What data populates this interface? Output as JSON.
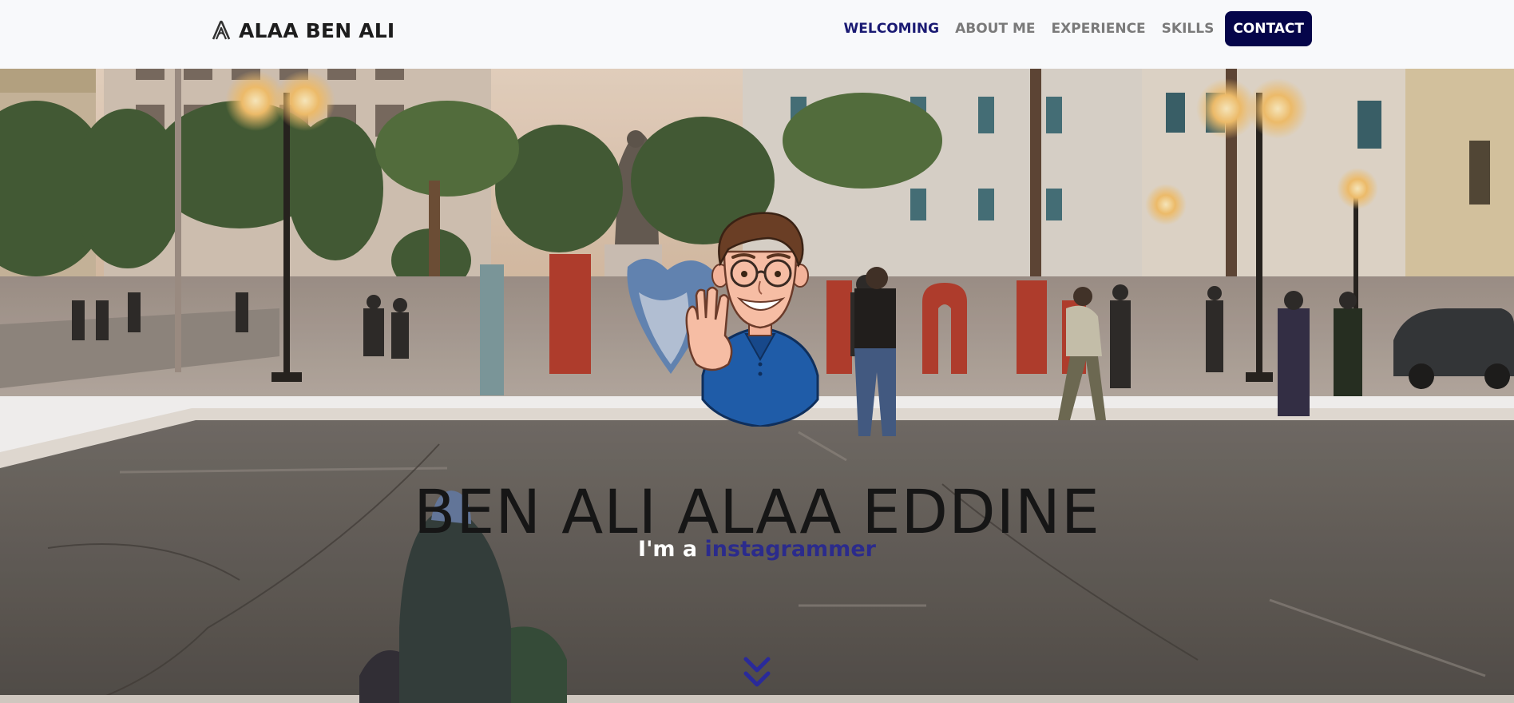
{
  "brand": {
    "name": "ALAA BEN ALI",
    "icon": "brand-logo-icon"
  },
  "nav": {
    "items": [
      {
        "label": "WELCOMING",
        "active": true
      },
      {
        "label": "ABOUT ME",
        "active": false
      },
      {
        "label": "EXPERIENCE",
        "active": false
      },
      {
        "label": "SKILLS",
        "active": false
      }
    ],
    "contact_label": "CONTACT"
  },
  "hero": {
    "title": "BEN ALI ALAA EDDINE",
    "subtitle_prefix": "I'm a ",
    "subtitle_typed": "instagrammer",
    "avatar": "cartoon-avatar-waving",
    "scroll_icon": "chevron-double-down-icon"
  },
  "colors": {
    "navbar_bg": "#f8f9fb",
    "nav_active": "#1a1a73",
    "nav_inactive": "#7a7a7a",
    "contact_bg": "#05054a",
    "typed_text": "#2b2b8c",
    "scroll_icon": "#2a2a9a"
  }
}
